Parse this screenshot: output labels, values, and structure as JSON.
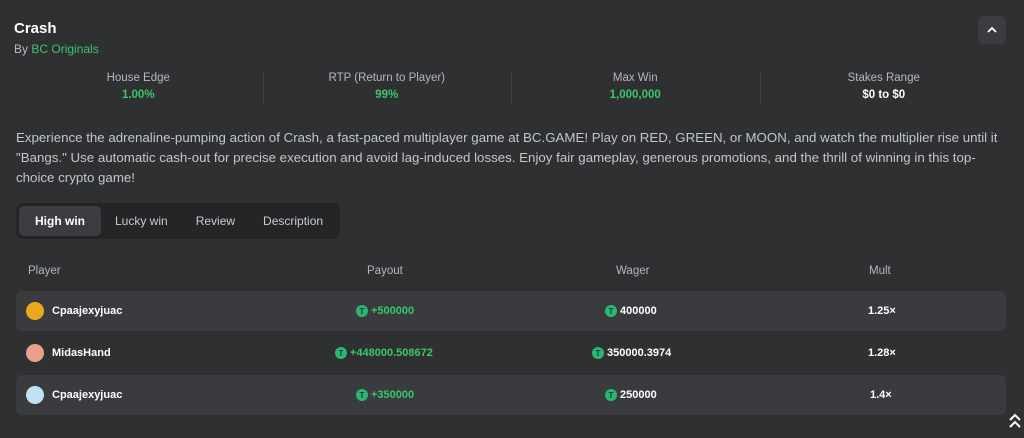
{
  "header": {
    "title": "Crash",
    "by_prefix": "By",
    "provider": "BC Originals"
  },
  "stats": [
    {
      "label": "House Edge",
      "value": "1.00%"
    },
    {
      "label": "RTP (Return to Player)",
      "value": "99%"
    },
    {
      "label": "Max Win",
      "value": "1,000,000"
    },
    {
      "label": "Stakes Range",
      "value": "$0 to $0"
    }
  ],
  "description": "Experience the adrenaline-pumping action of Crash, a fast-paced multiplayer game at BC.GAME! Play on RED, GREEN, or MOON, and watch the multiplier rise until it \"Bangs.\" Use automatic cash-out for precise execution and avoid lag-induced losses. Enjoy fair gameplay, generous promotions, and the thrill of winning in this top-choice crypto game!",
  "tabs": [
    {
      "label": "High win",
      "active": true
    },
    {
      "label": "Lucky win",
      "active": false
    },
    {
      "label": "Review",
      "active": false
    },
    {
      "label": "Description",
      "active": false
    }
  ],
  "table": {
    "headers": [
      "Player",
      "Payout",
      "Wager",
      "Mult"
    ],
    "currency_symbol": "T",
    "rows": [
      {
        "player": "Cpaajexyjuac",
        "payout": "+500000",
        "wager": "400000",
        "mult": "1.25×",
        "avatar_color": "#e8a91c"
      },
      {
        "player": "MidasHand",
        "payout": "+448000.508672",
        "wager": "350000.3974",
        "mult": "1.28×",
        "avatar_color": "#e8a08a"
      },
      {
        "player": "Cpaajexyjuac",
        "payout": "+350000",
        "wager": "250000",
        "mult": "1.4×",
        "avatar_color": "#bfe3f2"
      }
    ]
  },
  "icons": {
    "collapse": "chevron-up-icon",
    "scroll_top": "double-chevron-up-icon",
    "currency": "tether-coin-icon"
  },
  "colors": {
    "accent_green": "#3bc66b",
    "panel_bg": "#2e3032",
    "row_bg": "#393b3e"
  }
}
